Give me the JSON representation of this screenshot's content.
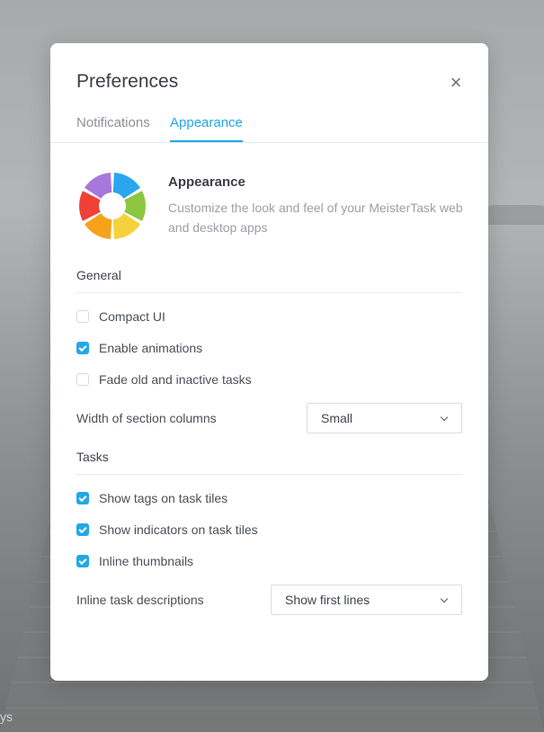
{
  "background": {
    "corner_text": "ys"
  },
  "modal": {
    "title": "Preferences",
    "close_icon": "×"
  },
  "tabs": [
    {
      "label": "Notifications",
      "active": false
    },
    {
      "label": "Appearance",
      "active": true
    }
  ],
  "header": {
    "icon": "color-wheel-logo",
    "title": "Appearance",
    "description": "Customize the look and feel of your MeisterTask web and desktop apps"
  },
  "general": {
    "heading": "General",
    "options": [
      {
        "label": "Compact UI",
        "checked": false
      },
      {
        "label": "Enable animations",
        "checked": true
      },
      {
        "label": "Fade old and inactive tasks",
        "checked": false
      }
    ],
    "column_width": {
      "label": "Width of section columns",
      "value": "Small"
    }
  },
  "tasks": {
    "heading": "Tasks",
    "options": [
      {
        "label": "Show tags on task tiles",
        "checked": true
      },
      {
        "label": "Show indicators on task tiles",
        "checked": true
      },
      {
        "label": "Inline thumbnails",
        "checked": true
      }
    ],
    "descriptions": {
      "label": "Inline task descriptions",
      "value": "Show first lines"
    }
  },
  "colors": {
    "accent": "#22a8e6",
    "logo_segments": [
      "#2aa6ef",
      "#8dc63f",
      "#f7d13b",
      "#f7a21b",
      "#ef4135",
      "#a678dd"
    ]
  }
}
